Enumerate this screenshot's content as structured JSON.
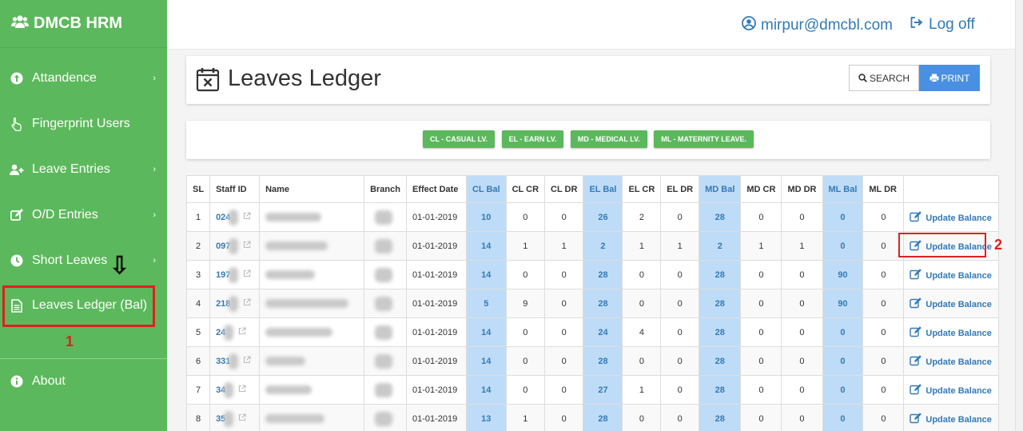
{
  "brand": {
    "title": "DMCB HRM",
    "icon": "users-icon"
  },
  "sidebar": {
    "items": [
      {
        "label": "Attandence",
        "icon": "arrow-up-circle-icon",
        "has_submenu": true
      },
      {
        "label": "Fingerprint Users",
        "icon": "hand-pointer-icon",
        "has_submenu": false
      },
      {
        "label": "Leave Entries",
        "icon": "user-plus-icon",
        "has_submenu": true
      },
      {
        "label": "O/D Entries",
        "icon": "edit-icon",
        "has_submenu": true
      },
      {
        "label": "Short Leaves",
        "icon": "clock-icon",
        "has_submenu": true
      },
      {
        "label": "Leaves Ledger (Bal)",
        "icon": "document-icon",
        "has_submenu": false
      },
      {
        "label": "About",
        "icon": "info-circle-icon",
        "has_submenu": false
      }
    ],
    "caret": "›"
  },
  "annotations": {
    "marker_1": "1",
    "marker_2": "2",
    "arrow": "⇩"
  },
  "topbar": {
    "user_email": "mirpur@dmcbl.com",
    "logoff_label": "Log off"
  },
  "page": {
    "title": "Leaves Ledger",
    "search_label": "SEARCH",
    "print_label": "PRINT"
  },
  "legend": [
    "CL - CASUAL LV.",
    "EL - EARN LV.",
    "MD - MEDICAL LV.",
    "ML - MATERNITY LEAVE."
  ],
  "table": {
    "headers": [
      "SL",
      "Staff ID",
      "Name",
      "Branch",
      "Effect Date",
      "CL Bal",
      "CL CR",
      "CL DR",
      "EL Bal",
      "EL CR",
      "EL DR",
      "MD Bal",
      "MD CR",
      "MD DR",
      "ML Bal",
      "ML DR"
    ],
    "action_label": "Update Balance",
    "rows": [
      {
        "sl": "1",
        "staff_id": "024",
        "effect_date": "01-01-2019",
        "cl_bal": "10",
        "cl_cr": "0",
        "cl_dr": "0",
        "el_bal": "26",
        "el_cr": "2",
        "el_dr": "0",
        "md_bal": "28",
        "md_cr": "0",
        "md_dr": "0",
        "ml_bal": "0",
        "ml_dr": "0"
      },
      {
        "sl": "2",
        "staff_id": "097",
        "effect_date": "01-01-2019",
        "cl_bal": "14",
        "cl_cr": "1",
        "cl_dr": "1",
        "el_bal": "2",
        "el_cr": "1",
        "el_dr": "1",
        "md_bal": "2",
        "md_cr": "1",
        "md_dr": "1",
        "ml_bal": "0",
        "ml_dr": "0"
      },
      {
        "sl": "3",
        "staff_id": "197",
        "effect_date": "01-01-2019",
        "cl_bal": "14",
        "cl_cr": "0",
        "cl_dr": "0",
        "el_bal": "28",
        "el_cr": "0",
        "el_dr": "0",
        "md_bal": "28",
        "md_cr": "0",
        "md_dr": "0",
        "ml_bal": "90",
        "ml_dr": "0"
      },
      {
        "sl": "4",
        "staff_id": "218",
        "effect_date": "01-01-2019",
        "cl_bal": "5",
        "cl_cr": "9",
        "cl_dr": "0",
        "el_bal": "28",
        "el_cr": "0",
        "el_dr": "0",
        "md_bal": "28",
        "md_cr": "0",
        "md_dr": "0",
        "ml_bal": "90",
        "ml_dr": "0"
      },
      {
        "sl": "5",
        "staff_id": "24",
        "effect_date": "01-01-2019",
        "cl_bal": "14",
        "cl_cr": "0",
        "cl_dr": "0",
        "el_bal": "24",
        "el_cr": "4",
        "el_dr": "0",
        "md_bal": "28",
        "md_cr": "0",
        "md_dr": "0",
        "ml_bal": "0",
        "ml_dr": "0"
      },
      {
        "sl": "6",
        "staff_id": "331",
        "effect_date": "01-01-2019",
        "cl_bal": "14",
        "cl_cr": "0",
        "cl_dr": "0",
        "el_bal": "28",
        "el_cr": "0",
        "el_dr": "0",
        "md_bal": "28",
        "md_cr": "0",
        "md_dr": "0",
        "ml_bal": "0",
        "ml_dr": "0"
      },
      {
        "sl": "7",
        "staff_id": "34",
        "effect_date": "01-01-2019",
        "cl_bal": "14",
        "cl_cr": "0",
        "cl_dr": "0",
        "el_bal": "27",
        "el_cr": "1",
        "el_dr": "0",
        "md_bal": "28",
        "md_cr": "0",
        "md_dr": "0",
        "ml_bal": "0",
        "ml_dr": "0"
      },
      {
        "sl": "8",
        "staff_id": "35",
        "effect_date": "01-01-2019",
        "cl_bal": "13",
        "cl_cr": "1",
        "cl_dr": "0",
        "el_bal": "28",
        "el_cr": "0",
        "el_dr": "0",
        "md_bal": "28",
        "md_cr": "0",
        "md_dr": "0",
        "ml_bal": "0",
        "ml_dr": "0"
      }
    ]
  },
  "colors": {
    "sidebar_green": "#5cb85c",
    "link_blue": "#337ab7",
    "highlight_blue": "#bedcf7",
    "annotation_red": "#e02020"
  }
}
